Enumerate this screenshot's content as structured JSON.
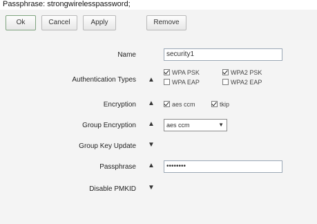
{
  "caption": "Passphrase: strongwirelesspassword;",
  "toolbar": {
    "ok_label": "Ok",
    "cancel_label": "Cancel",
    "apply_label": "Apply",
    "remove_label": "Remove"
  },
  "form": {
    "name": {
      "label": "Name",
      "value": "security1"
    },
    "auth_types": {
      "label": "Authentication Types",
      "options": [
        {
          "label": "WPA PSK",
          "checked": true
        },
        {
          "label": "WPA2 PSK",
          "checked": true
        },
        {
          "label": "WPA EAP",
          "checked": false
        },
        {
          "label": "WPA2 EAP",
          "checked": false
        }
      ]
    },
    "encryption": {
      "label": "Encryption",
      "options": [
        {
          "label": "aes ccm",
          "checked": true
        },
        {
          "label": "tkip",
          "checked": true
        }
      ]
    },
    "group_encryption": {
      "label": "Group Encryption",
      "value": "aes ccm"
    },
    "group_key_update": {
      "label": "Group Key Update"
    },
    "passphrase": {
      "label": "Passphrase",
      "value": "••••••••"
    },
    "disable_pmkid": {
      "label": "Disable PMKID"
    }
  },
  "icons": {
    "expanded_marker": "▲",
    "collapsed_marker": "▼"
  },
  "colors": {
    "form_bg": "#f4f4f4",
    "input_border": "#9aa7b5"
  }
}
